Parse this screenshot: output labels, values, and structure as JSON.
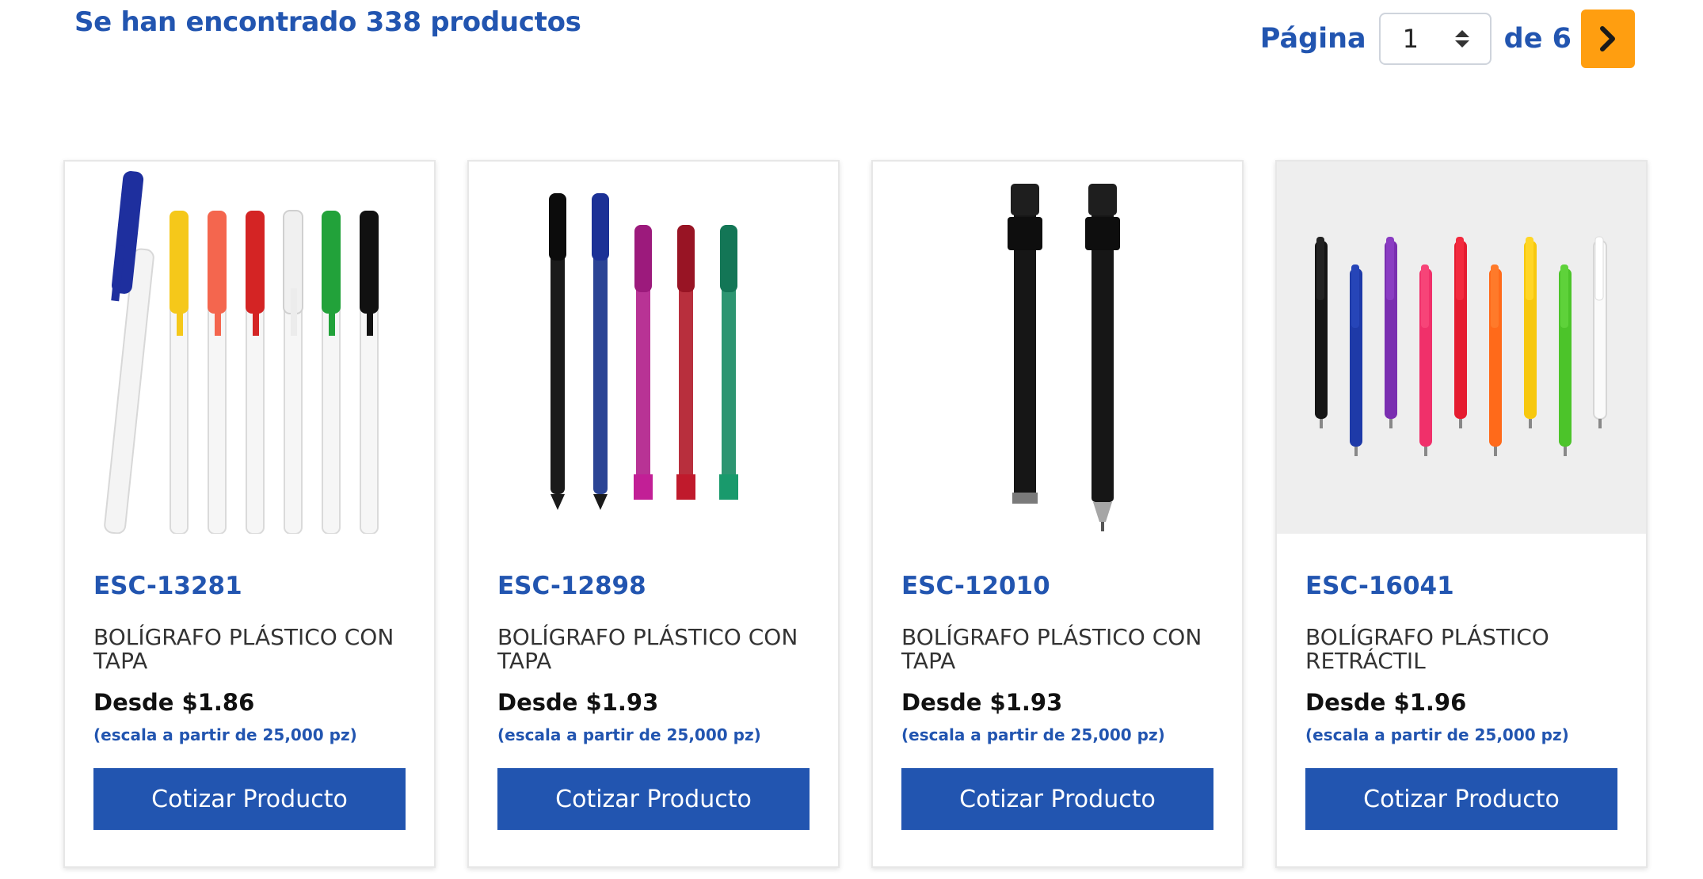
{
  "results": {
    "text": "Se han encontrado 338 productos"
  },
  "pagination": {
    "page_label": "Página",
    "current_page": "1",
    "of_label": "de 6"
  },
  "colors": {
    "brand_blue": "#2255b0",
    "accent_orange": "#ff9e10"
  },
  "products": [
    {
      "sku": "ESC-13281",
      "name": "BOLÍGRAFO PLÁSTICO CON TAPA",
      "price": "Desde $1.86",
      "scale": "(escala a partir de 25,000 pz)",
      "button": "Cotizar Producto",
      "image_icon": "pens-with-caps-multicolor-icon"
    },
    {
      "sku": "ESC-12898",
      "name": "BOLÍGRAFO PLÁSTICO CON TAPA",
      "price": "Desde $1.93",
      "scale": "(escala a partir de 25,000 pz)",
      "button": "Cotizar Producto",
      "image_icon": "translucent-pens-icon"
    },
    {
      "sku": "ESC-12010",
      "name": "BOLÍGRAFO PLÁSTICO CON TAPA",
      "price": "Desde $1.93",
      "scale": "(escala a partir de 25,000 pz)",
      "button": "Cotizar Producto",
      "image_icon": "black-pens-icon"
    },
    {
      "sku": "ESC-16041",
      "name": "BOLÍGRAFO PLÁSTICO RETRÁCTIL",
      "price": "Desde $1.96",
      "scale": "(escala a partir de 25,000 pz)",
      "button": "Cotizar Producto",
      "image_icon": "retractable-pens-multicolor-icon"
    }
  ]
}
